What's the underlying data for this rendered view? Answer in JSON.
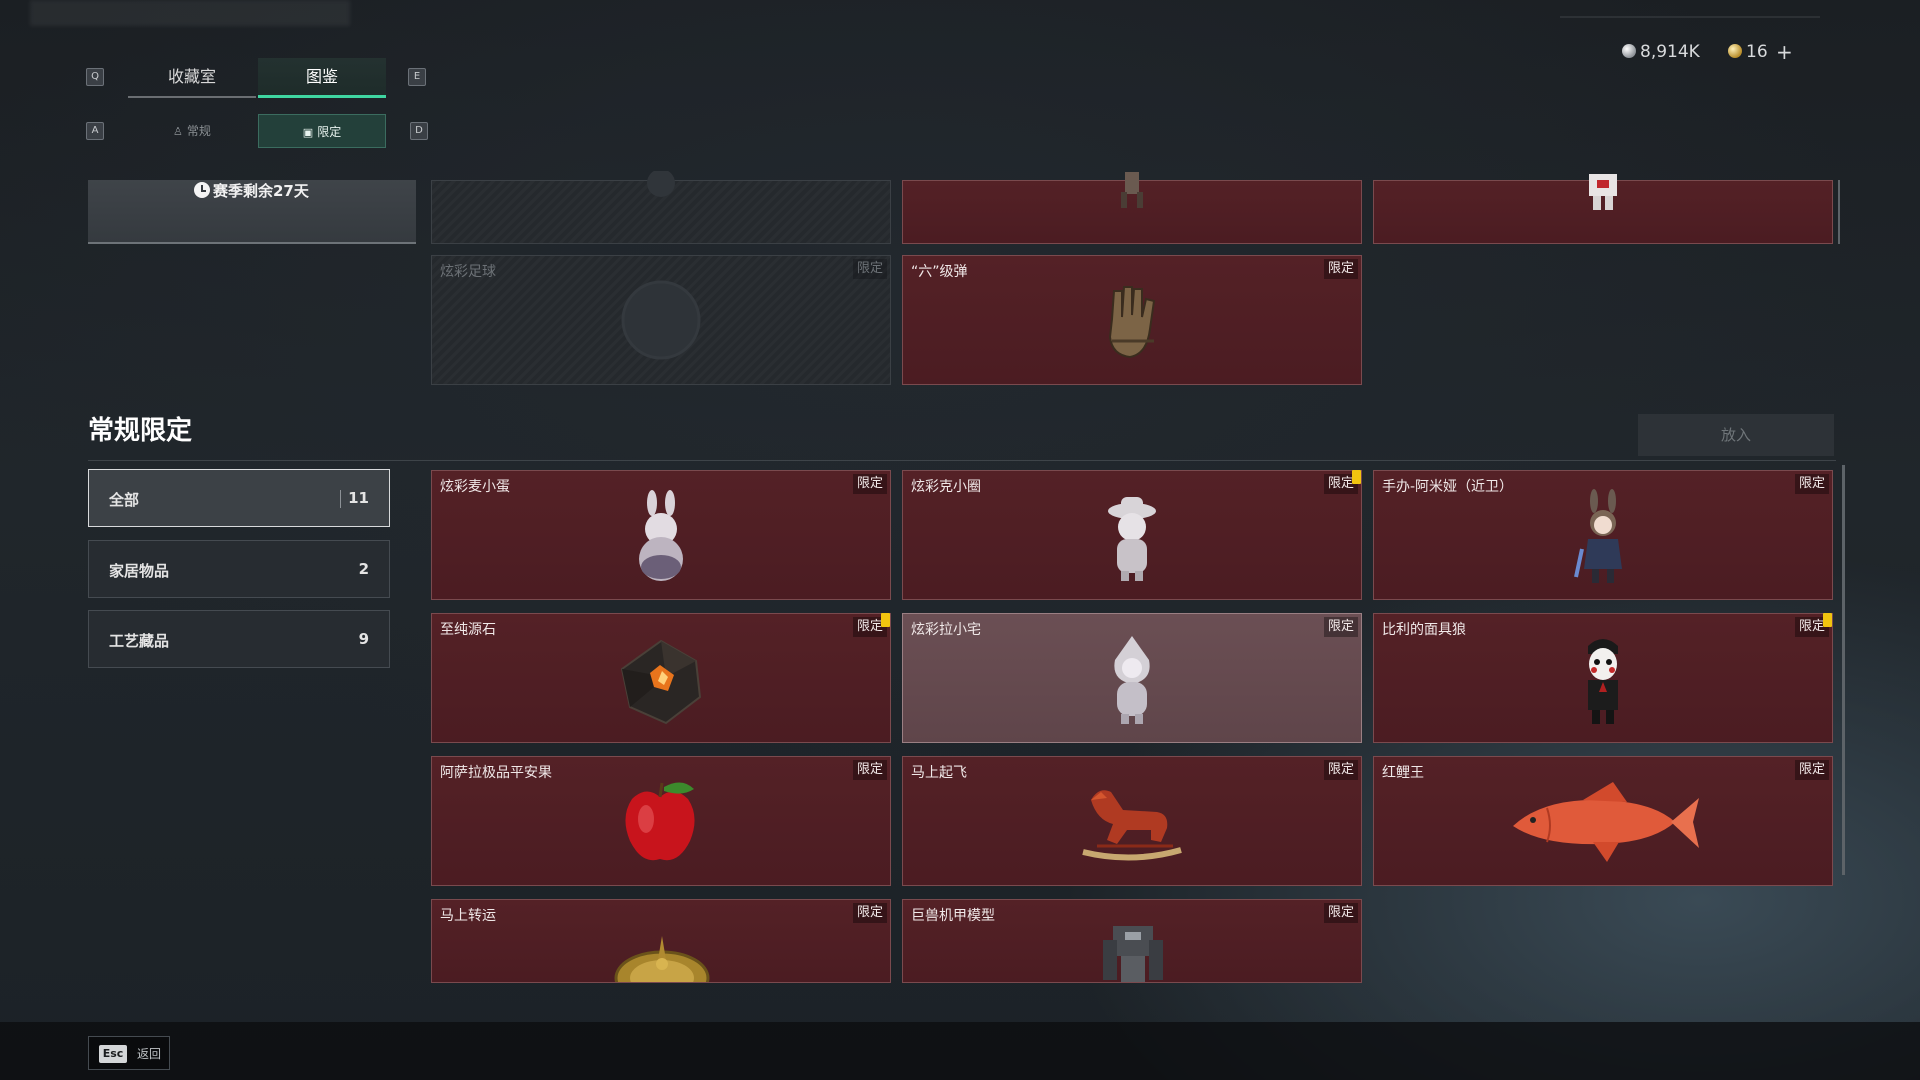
{
  "keys": {
    "prev_tab": "Q",
    "next_tab": "E",
    "prev_sub": "A",
    "next_sub": "D"
  },
  "tabs": [
    {
      "label": "收藏室",
      "active": false
    },
    {
      "label": "图鉴",
      "active": true
    }
  ],
  "subtabs": [
    {
      "label": "常规",
      "icon": "figure-icon",
      "active": false
    },
    {
      "label": "限定",
      "icon": "image-icon",
      "active": true
    }
  ],
  "currency": {
    "silver_amount": "8,914K",
    "gold_amount": "16",
    "add_label": "+"
  },
  "season": {
    "remaining": "赛季剩余27天"
  },
  "top_cards": [
    {
      "name": "",
      "tag": "",
      "locked": true,
      "art": "silhouette"
    },
    {
      "name": "",
      "tag": "",
      "locked": false,
      "art": "figure"
    },
    {
      "name": "",
      "tag": "",
      "locked": false,
      "art": "robot"
    },
    {
      "name": "炫彩足球",
      "tag": "限定",
      "locked": true,
      "art": "ball"
    },
    {
      "name": "“六”级弹",
      "tag": "限定",
      "locked": false,
      "art": "glove"
    }
  ],
  "section": {
    "title": "常规限定",
    "place_label": "放入"
  },
  "filters": [
    {
      "label": "全部",
      "count": "11",
      "active": true
    },
    {
      "label": "家居物品",
      "count": "2",
      "active": false
    },
    {
      "label": "工艺藏品",
      "count": "9",
      "active": false
    }
  ],
  "items": [
    {
      "name": "炫彩麦小蛋",
      "tag": "限定",
      "new": false,
      "highlight": false,
      "art": "bunny"
    },
    {
      "name": "炫彩克小圈",
      "tag": "限定",
      "new": true,
      "highlight": false,
      "art": "hat-figure"
    },
    {
      "name": "手办-阿米娅（近卫）",
      "tag": "限定",
      "new": false,
      "highlight": false,
      "art": "amiya"
    },
    {
      "name": "至纯源石",
      "tag": "限定",
      "new": true,
      "highlight": false,
      "art": "crystal"
    },
    {
      "name": "炫彩拉小宅",
      "tag": "限定",
      "new": false,
      "highlight": true,
      "art": "hood-figure"
    },
    {
      "name": "比利的面具狼",
      "tag": "限定",
      "new": true,
      "highlight": false,
      "art": "puppet"
    },
    {
      "name": "阿萨拉极品平安果",
      "tag": "限定",
      "new": false,
      "highlight": false,
      "art": "apple"
    },
    {
      "name": "马上起飞",
      "tag": "限定",
      "new": false,
      "highlight": false,
      "art": "horse"
    },
    {
      "name": "红鲤王",
      "tag": "限定",
      "new": false,
      "highlight": false,
      "art": "carp"
    },
    {
      "name": "马上转运",
      "tag": "限定",
      "new": false,
      "highlight": false,
      "art": "compass"
    },
    {
      "name": "巨兽机甲模型",
      "tag": "限定",
      "new": false,
      "highlight": false,
      "art": "mech"
    }
  ],
  "footer": {
    "esc_key": "Esc",
    "back_label": "返回"
  }
}
